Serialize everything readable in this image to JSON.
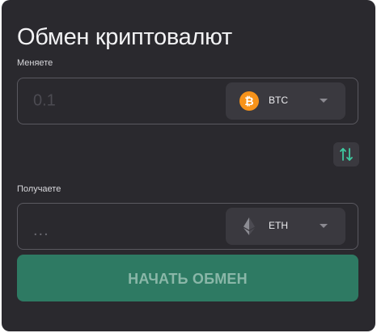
{
  "title": "Обмен криптовалют",
  "give": {
    "label": "Меняете",
    "amount_placeholder": "0.1",
    "currency": {
      "name": "BTC",
      "icon": "bitcoin-icon",
      "icon_color": "#f7931a"
    }
  },
  "swap": {
    "icon": "swap-arrows-icon",
    "color": "#3ec9a0"
  },
  "get": {
    "label": "Получаете",
    "amount_text": "...",
    "currency": {
      "name": "ETH",
      "icon": "ethereum-icon"
    }
  },
  "action": {
    "label": "НАЧАТЬ ОБМЕН",
    "color": "#2e7a63"
  },
  "colors": {
    "card_background": "#2a292e",
    "field_border": "#5a5960",
    "select_background": "#3a393f"
  }
}
